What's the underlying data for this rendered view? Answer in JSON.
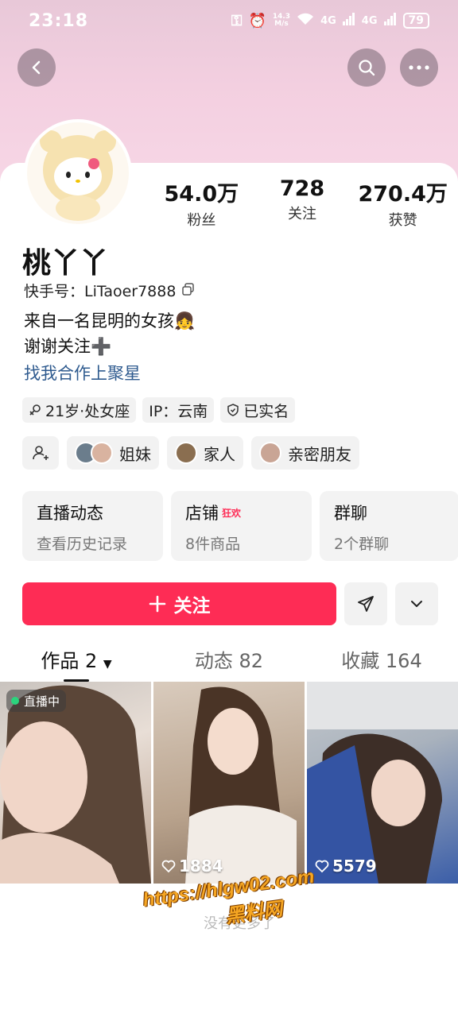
{
  "status": {
    "time": "23:18",
    "net_speed": "14.3\nM/s",
    "signal1": "4G",
    "signal2": "4G",
    "battery": "79"
  },
  "profile": {
    "name": "桃丫丫",
    "uid": "快手号：LiTaoer7888",
    "bio_line1": "来自一名昆明的女孩👧",
    "bio_line2": "谢谢关注➕",
    "bio_link": "找我合作上聚星"
  },
  "stats": [
    {
      "value": "54.0万",
      "label": "粉丝"
    },
    {
      "value": "728",
      "label": "关注"
    },
    {
      "value": "270.4万",
      "label": "获赞"
    }
  ],
  "tags": {
    "age": "21岁·处女座",
    "ip": "IP：云南",
    "verified": "已实名"
  },
  "groups": {
    "sister": "姐妹",
    "family": "家人",
    "close": "亲密朋友"
  },
  "features": [
    {
      "title": "直播动态",
      "badge": "",
      "sub": "查看历史记录"
    },
    {
      "title": "店铺",
      "badge": "狂欢",
      "sub": "8件商品"
    },
    {
      "title": "群聊",
      "badge": "",
      "sub": "2个群聊"
    }
  ],
  "actions": {
    "follow": "关注"
  },
  "tabs": [
    {
      "label": "作品 2"
    },
    {
      "label": "动态 82"
    },
    {
      "label": "收藏 164"
    }
  ],
  "videos": [
    {
      "badge": "直播中",
      "likes": ""
    },
    {
      "badge": "",
      "likes": "1884"
    },
    {
      "badge": "",
      "likes": "5579"
    }
  ],
  "watermark": {
    "line1": "https://hlgw02.com",
    "line2": "黑料网"
  },
  "footer_hint": "没有更多了"
}
